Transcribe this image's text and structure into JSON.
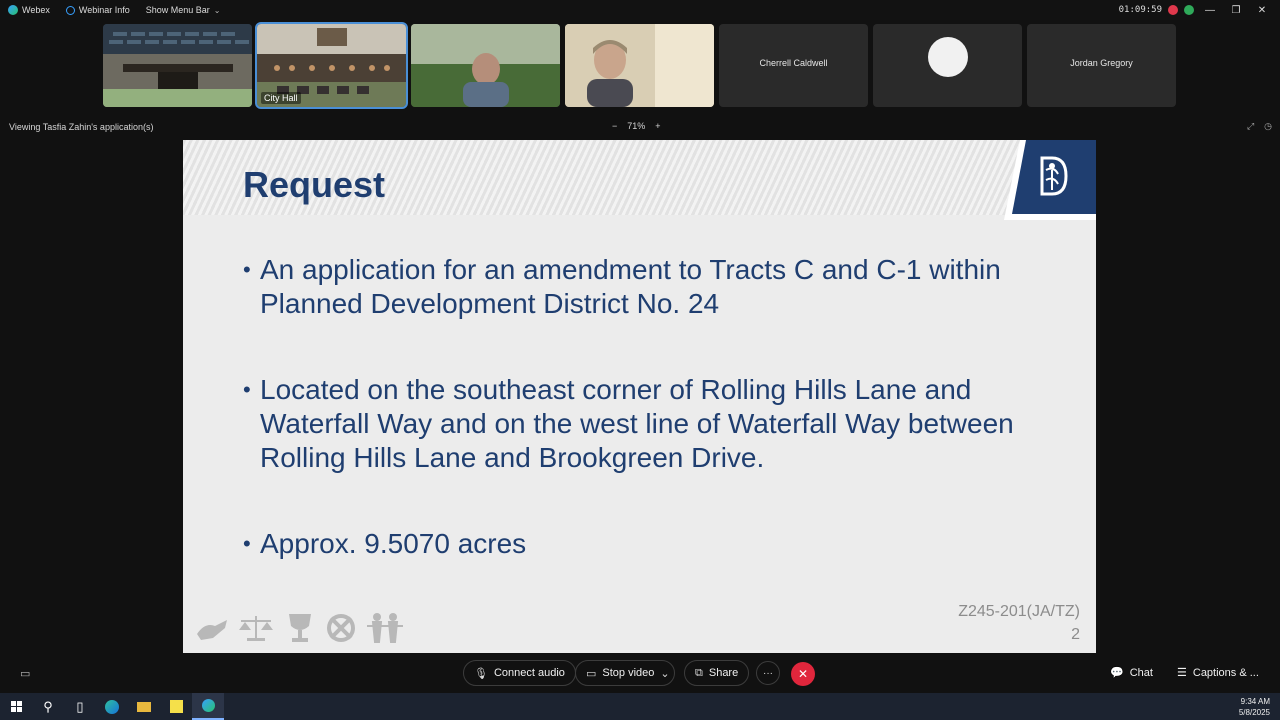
{
  "menubar": {
    "app_name": "Webex",
    "webinar_info": "Webinar Info",
    "show_menu_bar": "Show Menu Bar",
    "timer": "01:09:59"
  },
  "participants": [
    {
      "label": ""
    },
    {
      "label": "City Hall"
    },
    {
      "label": ""
    },
    {
      "label": ""
    },
    {
      "name": "Cherrell Caldwell"
    },
    {
      "name": ""
    },
    {
      "name": "Jordan Gregory"
    }
  ],
  "viewbar": {
    "viewing": "Viewing Tasfia Zahin's application(s)",
    "zoom": "71%",
    "zoom_out": "−",
    "zoom_in": "+"
  },
  "slide": {
    "title": "Request",
    "bullets": [
      "An application for an amendment to Tracts C and C-1 within Planned Development District No. 24",
      "Located on the southeast corner of Rolling Hills Lane and Waterfall Way and on the west line of Waterfall Way between Rolling Hills Lane and Brookgreen Drive.",
      "Approx. 9.5070 acres"
    ],
    "case_code": "Z245-201(JA/TZ)",
    "page_number": "2",
    "brand_color": "#1f3e70"
  },
  "controls": {
    "connect_audio": "Connect audio",
    "stop_video": "Stop video",
    "share": "Share",
    "more": "···",
    "end": "✕",
    "chat": "Chat",
    "captions": "Captions & ..."
  },
  "taskbar": {
    "time": "9:34 AM",
    "date": "5/8/2025"
  }
}
